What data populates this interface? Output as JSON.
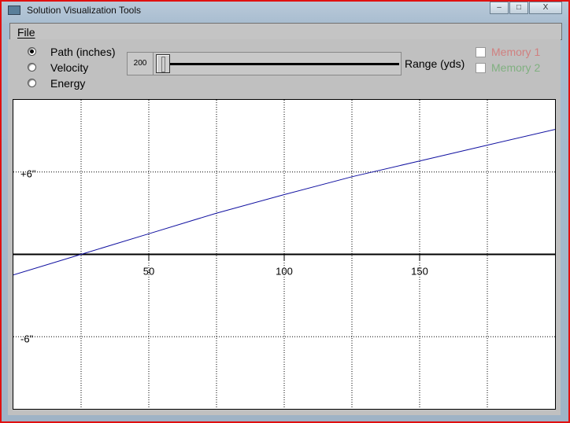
{
  "window": {
    "title": "Solution Visualization Tools",
    "minimize": "–",
    "maximize": "□",
    "close": "X"
  },
  "menu": {
    "file": "File"
  },
  "modes": [
    {
      "label": "Path (inches)",
      "selected": true
    },
    {
      "label": "Velocity",
      "selected": false
    },
    {
      "label": "Energy",
      "selected": false
    }
  ],
  "slider": {
    "value": "200",
    "label": "Range (yds)",
    "fraction": 0.0
  },
  "memories": [
    {
      "label": "Memory 1",
      "checked": false,
      "color": "#d08080"
    },
    {
      "label": "Memory 2",
      "checked": false,
      "color": "#80b080"
    }
  ],
  "chart_data": {
    "type": "line",
    "xlim": [
      0,
      200
    ],
    "ylim": [
      -11.25,
      11.25
    ],
    "x_grid": [
      25,
      50,
      75,
      100,
      125,
      150,
      175
    ],
    "x_tick_labels": [
      {
        "value": 50,
        "label": "50"
      },
      {
        "value": 100,
        "label": "100"
      },
      {
        "value": 150,
        "label": "150"
      }
    ],
    "y_grid": [
      {
        "value": 6,
        "label": "+6\""
      },
      {
        "value": -6,
        "label": "-6\""
      }
    ],
    "series": [
      {
        "name": "Path",
        "color": "#1010a0",
        "x": [
          0,
          25,
          50,
          75,
          100,
          125,
          150,
          175,
          200
        ],
        "y": [
          -1.5,
          0,
          1.5,
          3.0,
          4.35,
          5.65,
          6.8,
          7.95,
          9.1
        ]
      }
    ]
  }
}
